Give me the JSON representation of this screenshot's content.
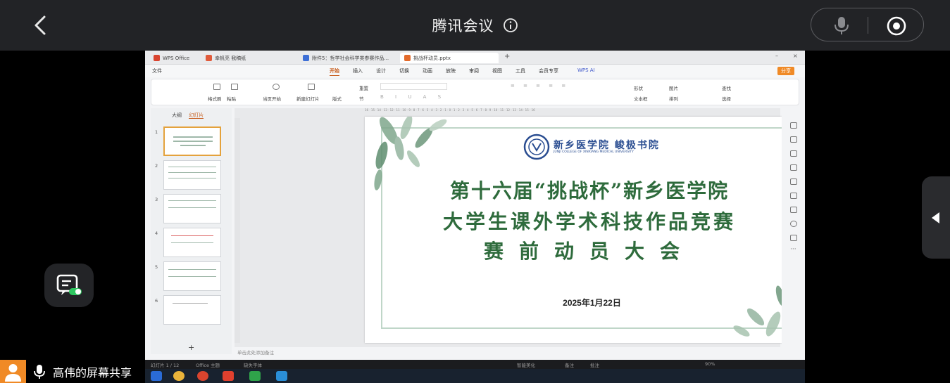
{
  "meeting": {
    "title": "腾讯会议",
    "share_label": "高伟的屏幕共享"
  },
  "icons": {
    "back": "chevron-left-icon",
    "info": "info-icon",
    "mic": "microphone-icon",
    "record": "record-icon",
    "chat": "chat-bubble-icon",
    "side_toggle": "triangle-left-icon",
    "avatar": "user-avatar-icon"
  },
  "colors": {
    "topbar": "#222326",
    "avatar": "#f08a26",
    "slide_title": "#2e6b3c",
    "accent": "#c75b1a"
  },
  "wps": {
    "tabs": [
      "WPS Office",
      "幸帆亮 我稿纸",
      "附件5：哲学社会科学类参赛作品...",
      "挑战杯动员.pptx"
    ],
    "menu": [
      "开始",
      "插入",
      "设计",
      "切换",
      "动画",
      "放映",
      "审阅",
      "视图",
      "工具",
      "会员专享"
    ],
    "menu_left": "文件",
    "wps_ai": "WPS AI",
    "share_btn": "分享",
    "ribbon": {
      "format_painter": "格式刷",
      "paste": "粘贴",
      "from_current": "当页开始",
      "new_slide": "新建幻灯片",
      "layout": "版式",
      "section": "节",
      "reset": "重置",
      "shape": "形状",
      "picture": "图片",
      "textbox": "文本框",
      "arrange": "排列",
      "find": "查找",
      "select": "选择"
    },
    "side_tabs": [
      "大纲",
      "幻灯片"
    ],
    "slide_numbers": [
      "1",
      "2",
      "3",
      "4",
      "5",
      "6"
    ],
    "notes_placeholder": "单击此处添加备注",
    "add_slide": "+",
    "status": {
      "slide_count": "幻灯片 1 / 12",
      "theme": "Office 主题",
      "font_missing": "缺失字体",
      "smart_beauty": "智能美化",
      "notes": "备注",
      "comments": "批注",
      "zoom": "90%"
    }
  },
  "slide": {
    "school_name": "新乡医学院 峻极书院",
    "school_name_en": "JUNJI COLLEGE OF XINXIANG MEDICAL UNIVERSITY",
    "title_line1": "第十六届“挑战杯”新乡医学院",
    "title_line2": "大学生课外学术科技作品竞赛",
    "title_line3": "赛前动员大会",
    "date": "2025年1月22日"
  }
}
